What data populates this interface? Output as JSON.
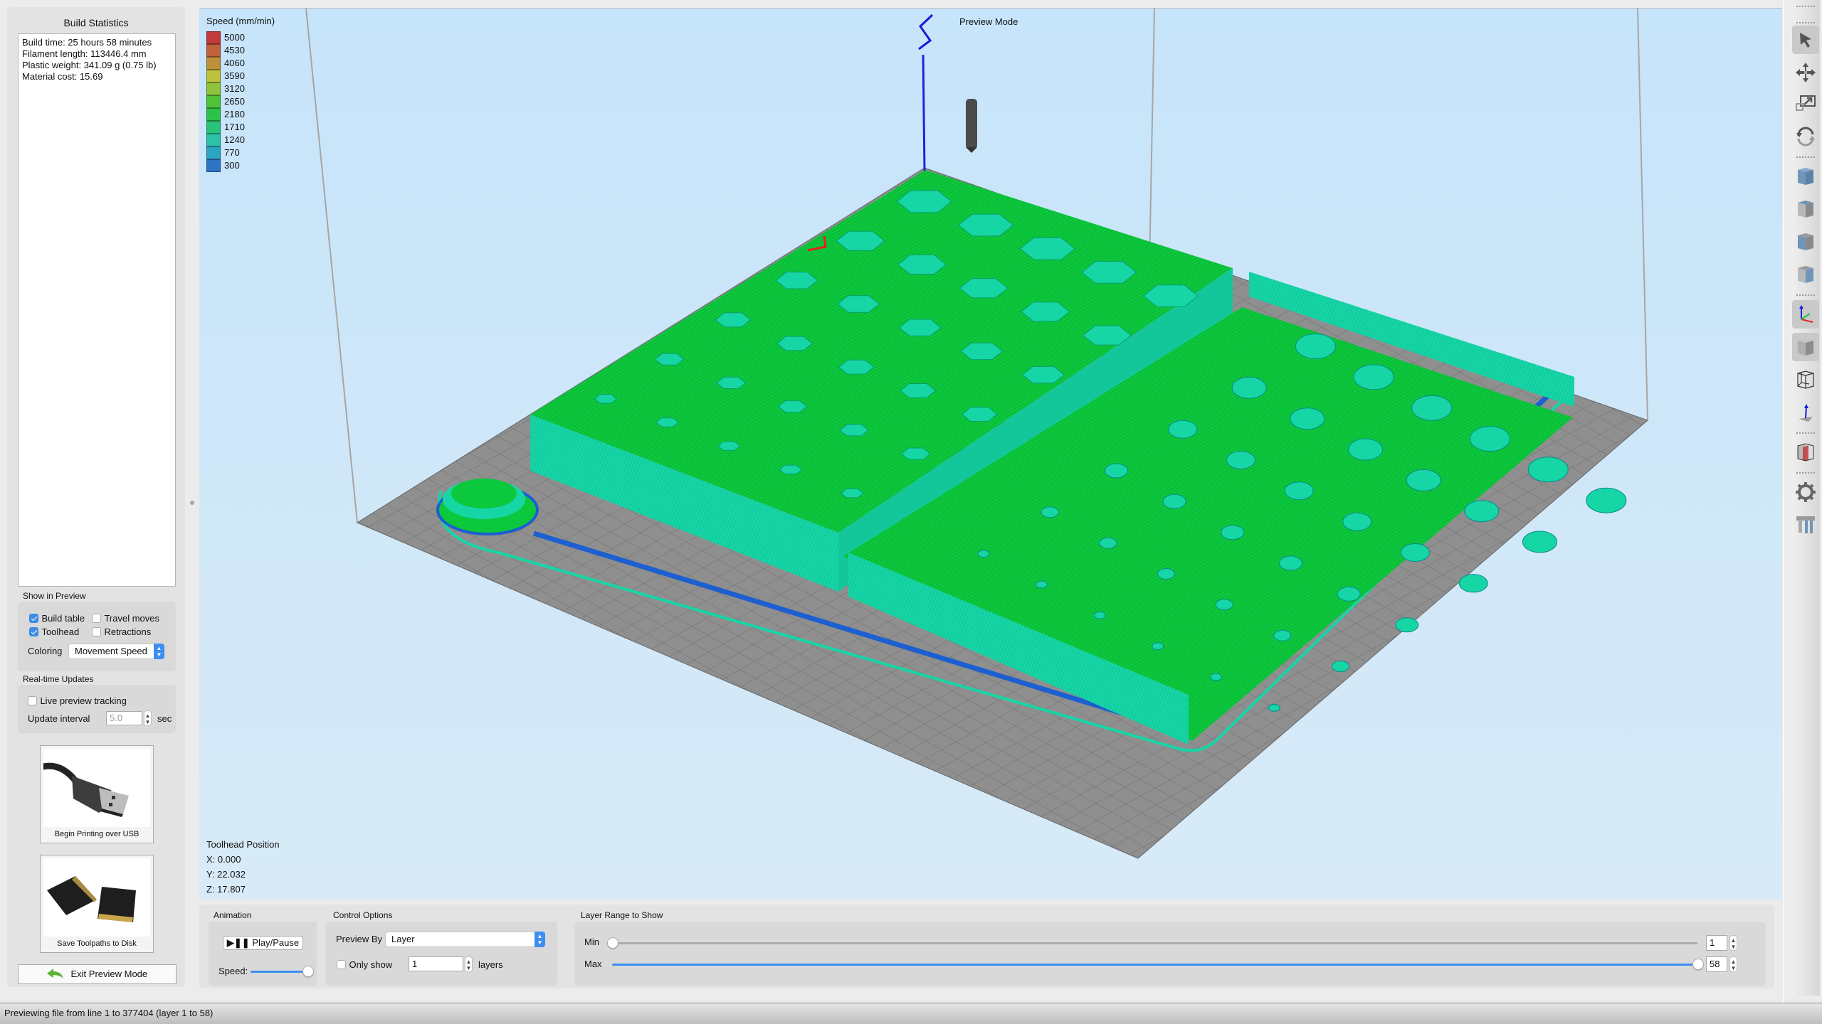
{
  "left_panel": {
    "build_statistics": {
      "title": "Build Statistics",
      "lines": [
        "Build time: 25 hours 58 minutes",
        "Filament length: 113446.4 mm",
        "Plastic weight: 341.09 g (0.75 lb)",
        "Material cost: 15.69"
      ]
    },
    "show_in_preview": {
      "label": "Show in Preview",
      "build_table": {
        "label": "Build table",
        "checked": true
      },
      "travel_moves": {
        "label": "Travel moves",
        "checked": false
      },
      "toolhead": {
        "label": "Toolhead",
        "checked": true
      },
      "retractions": {
        "label": "Retractions",
        "checked": false
      },
      "coloring_label": "Coloring",
      "coloring_value": "Movement Speed"
    },
    "realtime_updates": {
      "label": "Real-time Updates",
      "live_tracking": {
        "label": "Live preview tracking",
        "checked": false
      },
      "update_interval_label": "Update interval",
      "update_interval_value": "5.0",
      "update_interval_unit": "sec"
    },
    "usb_tile": {
      "caption": "Begin Printing over USB",
      "icon": "usb-cable-image"
    },
    "disk_tile": {
      "caption": "Save Toolpaths to Disk",
      "icon": "sd-card-image"
    },
    "exit_button": {
      "label": "Exit Preview Mode",
      "icon": "back-arrow-icon"
    }
  },
  "viewport": {
    "mode_label": "Preview Mode",
    "legend": {
      "title": "Speed (mm/min)",
      "entries": [
        {
          "value": "5000",
          "color": "#c23a3a"
        },
        {
          "value": "4530",
          "color": "#c0623a"
        },
        {
          "value": "4060",
          "color": "#bf903a"
        },
        {
          "value": "3590",
          "color": "#bdc23a"
        },
        {
          "value": "3120",
          "color": "#8ec23a"
        },
        {
          "value": "2650",
          "color": "#4fc23a"
        },
        {
          "value": "2180",
          "color": "#2bc24a"
        },
        {
          "value": "1710",
          "color": "#2bc27a"
        },
        {
          "value": "1240",
          "color": "#2bc2a8"
        },
        {
          "value": "770",
          "color": "#2ba6c2"
        },
        {
          "value": "300",
          "color": "#2f73c6"
        }
      ]
    },
    "toolhead_position": {
      "title": "Toolhead Position",
      "x": "X: 0.000",
      "y": "Y: 22.032",
      "z": "Z: 17.807"
    },
    "colors": {
      "bed": "#8f8f8f",
      "bed_grid": "#6e6e6e",
      "fill_green": "#0cc83c",
      "wall_teal": "#16d6a6",
      "base_blue": "#1c5fd0",
      "toolhead": "#4a4a4a"
    }
  },
  "bottom_panel": {
    "animation": {
      "label": "Animation",
      "play_pause_label": "Play/Pause",
      "speed_label": "Speed:",
      "speed_fraction": 1.0
    },
    "control_options": {
      "label": "Control Options",
      "preview_by_label": "Preview By",
      "preview_by_value": "Layer",
      "only_show": {
        "label": "Only show",
        "checked": false
      },
      "only_show_value": "1",
      "layers_label": "layers"
    },
    "layer_range": {
      "label": "Layer Range to Show",
      "min_label": "Min",
      "max_label": "Max",
      "min_value": "1",
      "max_value": "58",
      "layer_count": 58
    }
  },
  "right_toolbar": {
    "tools": [
      {
        "name": "select-tool",
        "icon": "cursor-arrow-icon",
        "active": true
      },
      {
        "name": "move-tool",
        "icon": "move-arrows-icon"
      },
      {
        "name": "scale-tool",
        "icon": "scale-icon"
      },
      {
        "name": "rotate-tool",
        "icon": "rotate-icon"
      },
      {
        "name": "view-iso",
        "icon": "cube-iso-icon"
      },
      {
        "name": "view-top",
        "icon": "cube-top-icon"
      },
      {
        "name": "view-front",
        "icon": "cube-front-icon"
      },
      {
        "name": "view-right",
        "icon": "cube-right-icon"
      },
      {
        "name": "toggle-axes",
        "icon": "axes-icon",
        "active": true
      },
      {
        "name": "toggle-solid",
        "icon": "solid-cube-icon",
        "active": true
      },
      {
        "name": "toggle-wireframe",
        "icon": "wireframe-cube-icon"
      },
      {
        "name": "toggle-normals",
        "icon": "normal-arrow-icon"
      },
      {
        "name": "section-view",
        "icon": "section-cube-icon"
      },
      {
        "name": "settings",
        "icon": "gear-icon"
      },
      {
        "name": "supports",
        "icon": "supports-icon"
      }
    ]
  },
  "status_bar": {
    "text": "Previewing file from line 1 to 377404 (layer 1 to 58)"
  }
}
